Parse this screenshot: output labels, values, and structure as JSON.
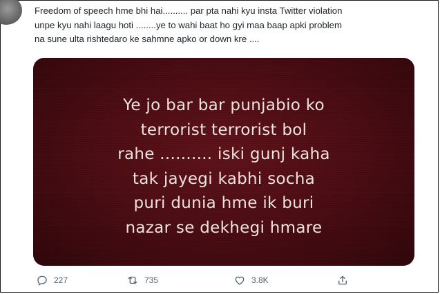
{
  "tweet": {
    "text_lines": [
      "Freedom of speech hme bhi hai.......... par pta nahi kyu insta Twitter violation",
      "unpe kyu nahi laagu hoti ........ye to wahi baat ho gyi maa baap apki problem",
      "na sune ulta rishtedaro ke sahmne apko or down kre ...."
    ]
  },
  "media": {
    "lines": [
      "Ye jo bar bar punjabio ko",
      "terrorist terrorist bol",
      "rahe .......... iski gunj kaha",
      "tak jayegi kabhi socha",
      "puri dunia hme ik buri",
      "nazar se dekhegi hmare"
    ]
  },
  "actions": {
    "reply": {
      "icon": "reply-icon",
      "count": "227"
    },
    "retweet": {
      "icon": "retweet-icon",
      "count": "735"
    },
    "like": {
      "icon": "heart-icon",
      "count": "3.8K"
    },
    "share": {
      "icon": "share-icon"
    }
  },
  "colors": {
    "text": "#1d2327",
    "action_gray": "#536471",
    "media_bg": "#4a0b12",
    "media_text": "#f2e6e3"
  }
}
